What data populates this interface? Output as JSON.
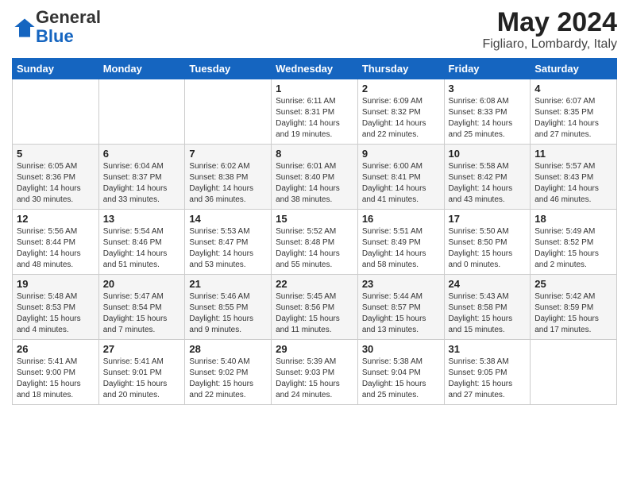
{
  "header": {
    "logo_general": "General",
    "logo_blue": "Blue",
    "month_title": "May 2024",
    "location": "Figliaro, Lombardy, Italy"
  },
  "weekdays": [
    "Sunday",
    "Monday",
    "Tuesday",
    "Wednesday",
    "Thursday",
    "Friday",
    "Saturday"
  ],
  "weeks": [
    [
      {
        "day": "",
        "info": ""
      },
      {
        "day": "",
        "info": ""
      },
      {
        "day": "",
        "info": ""
      },
      {
        "day": "1",
        "info": "Sunrise: 6:11 AM\nSunset: 8:31 PM\nDaylight: 14 hours\nand 19 minutes."
      },
      {
        "day": "2",
        "info": "Sunrise: 6:09 AM\nSunset: 8:32 PM\nDaylight: 14 hours\nand 22 minutes."
      },
      {
        "day": "3",
        "info": "Sunrise: 6:08 AM\nSunset: 8:33 PM\nDaylight: 14 hours\nand 25 minutes."
      },
      {
        "day": "4",
        "info": "Sunrise: 6:07 AM\nSunset: 8:35 PM\nDaylight: 14 hours\nand 27 minutes."
      }
    ],
    [
      {
        "day": "5",
        "info": "Sunrise: 6:05 AM\nSunset: 8:36 PM\nDaylight: 14 hours\nand 30 minutes."
      },
      {
        "day": "6",
        "info": "Sunrise: 6:04 AM\nSunset: 8:37 PM\nDaylight: 14 hours\nand 33 minutes."
      },
      {
        "day": "7",
        "info": "Sunrise: 6:02 AM\nSunset: 8:38 PM\nDaylight: 14 hours\nand 36 minutes."
      },
      {
        "day": "8",
        "info": "Sunrise: 6:01 AM\nSunset: 8:40 PM\nDaylight: 14 hours\nand 38 minutes."
      },
      {
        "day": "9",
        "info": "Sunrise: 6:00 AM\nSunset: 8:41 PM\nDaylight: 14 hours\nand 41 minutes."
      },
      {
        "day": "10",
        "info": "Sunrise: 5:58 AM\nSunset: 8:42 PM\nDaylight: 14 hours\nand 43 minutes."
      },
      {
        "day": "11",
        "info": "Sunrise: 5:57 AM\nSunset: 8:43 PM\nDaylight: 14 hours\nand 46 minutes."
      }
    ],
    [
      {
        "day": "12",
        "info": "Sunrise: 5:56 AM\nSunset: 8:44 PM\nDaylight: 14 hours\nand 48 minutes."
      },
      {
        "day": "13",
        "info": "Sunrise: 5:54 AM\nSunset: 8:46 PM\nDaylight: 14 hours\nand 51 minutes."
      },
      {
        "day": "14",
        "info": "Sunrise: 5:53 AM\nSunset: 8:47 PM\nDaylight: 14 hours\nand 53 minutes."
      },
      {
        "day": "15",
        "info": "Sunrise: 5:52 AM\nSunset: 8:48 PM\nDaylight: 14 hours\nand 55 minutes."
      },
      {
        "day": "16",
        "info": "Sunrise: 5:51 AM\nSunset: 8:49 PM\nDaylight: 14 hours\nand 58 minutes."
      },
      {
        "day": "17",
        "info": "Sunrise: 5:50 AM\nSunset: 8:50 PM\nDaylight: 15 hours\nand 0 minutes."
      },
      {
        "day": "18",
        "info": "Sunrise: 5:49 AM\nSunset: 8:52 PM\nDaylight: 15 hours\nand 2 minutes."
      }
    ],
    [
      {
        "day": "19",
        "info": "Sunrise: 5:48 AM\nSunset: 8:53 PM\nDaylight: 15 hours\nand 4 minutes."
      },
      {
        "day": "20",
        "info": "Sunrise: 5:47 AM\nSunset: 8:54 PM\nDaylight: 15 hours\nand 7 minutes."
      },
      {
        "day": "21",
        "info": "Sunrise: 5:46 AM\nSunset: 8:55 PM\nDaylight: 15 hours\nand 9 minutes."
      },
      {
        "day": "22",
        "info": "Sunrise: 5:45 AM\nSunset: 8:56 PM\nDaylight: 15 hours\nand 11 minutes."
      },
      {
        "day": "23",
        "info": "Sunrise: 5:44 AM\nSunset: 8:57 PM\nDaylight: 15 hours\nand 13 minutes."
      },
      {
        "day": "24",
        "info": "Sunrise: 5:43 AM\nSunset: 8:58 PM\nDaylight: 15 hours\nand 15 minutes."
      },
      {
        "day": "25",
        "info": "Sunrise: 5:42 AM\nSunset: 8:59 PM\nDaylight: 15 hours\nand 17 minutes."
      }
    ],
    [
      {
        "day": "26",
        "info": "Sunrise: 5:41 AM\nSunset: 9:00 PM\nDaylight: 15 hours\nand 18 minutes."
      },
      {
        "day": "27",
        "info": "Sunrise: 5:41 AM\nSunset: 9:01 PM\nDaylight: 15 hours\nand 20 minutes."
      },
      {
        "day": "28",
        "info": "Sunrise: 5:40 AM\nSunset: 9:02 PM\nDaylight: 15 hours\nand 22 minutes."
      },
      {
        "day": "29",
        "info": "Sunrise: 5:39 AM\nSunset: 9:03 PM\nDaylight: 15 hours\nand 24 minutes."
      },
      {
        "day": "30",
        "info": "Sunrise: 5:38 AM\nSunset: 9:04 PM\nDaylight: 15 hours\nand 25 minutes."
      },
      {
        "day": "31",
        "info": "Sunrise: 5:38 AM\nSunset: 9:05 PM\nDaylight: 15 hours\nand 27 minutes."
      },
      {
        "day": "",
        "info": ""
      }
    ]
  ]
}
